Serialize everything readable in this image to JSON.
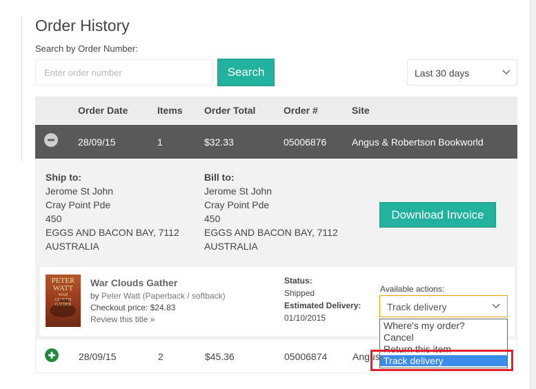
{
  "page": {
    "title": "Order History"
  },
  "search": {
    "label": "Search by Order Number:",
    "placeholder": "Enter order number",
    "button_label": "Search"
  },
  "date_filter": {
    "selected": "Last 30 days"
  },
  "table": {
    "headers": [
      "Order Date",
      "Items",
      "Order Total",
      "Order #",
      "Site"
    ],
    "rows": [
      {
        "expanded": true,
        "date": "28/09/15",
        "items": "1",
        "total": "$32.33",
        "order_no": "05006876",
        "site": "Angus & Robertson Bookworld"
      },
      {
        "expanded": false,
        "date": "28/09/15",
        "items": "2",
        "total": "$45.36",
        "order_no": "05006874",
        "site": "Angus & Robertson Bookworld"
      }
    ]
  },
  "details": {
    "ship_to": {
      "label": "Ship to:",
      "lines": [
        "Jerome St John",
        "Cray Point Pde",
        "450",
        "EGGS AND BACON BAY, 7112",
        "AUSTRALIA"
      ]
    },
    "bill_to": {
      "label": "Bill to:",
      "lines": [
        "Jerome St John",
        "Cray Point Pde",
        "450",
        "EGGS AND BACON BAY, 7112",
        "AUSTRALIA"
      ]
    },
    "invoice_button": "Download Invoice",
    "item": {
      "cover_text": [
        "PETER",
        "WATT",
        "WAR",
        "CLOUDS",
        "GATHER"
      ],
      "title": "War Clouds Gather",
      "by": "by",
      "author": "Peter Watt (Paperback / softback)",
      "checkout_label": "Checkout price:",
      "checkout_price": "$24.83",
      "review_link": "Review this title »",
      "status_label": "Status:",
      "status": "Shipped",
      "est_label": "Estimated Delivery:",
      "est_date": "01/10/2015",
      "actions_label": "Available actions:",
      "actions_selected": "Track delivery",
      "actions_options": [
        "Where's my order?",
        "Cancel",
        "Return this item",
        "Track delivery"
      ]
    }
  },
  "colors": {
    "accent": "#22b19c",
    "expanded_row": "#595959",
    "highlight": "#e41e2c",
    "selected_option": "#3b8be8"
  },
  "icons": {
    "collapse": "minus-circle-icon",
    "expand": "plus-circle-icon",
    "dropdown": "chevron-down-icon"
  }
}
